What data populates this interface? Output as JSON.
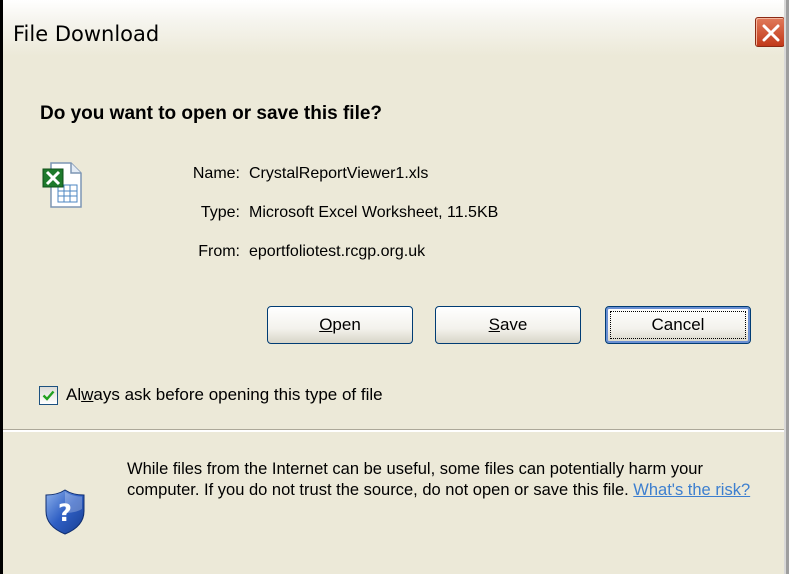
{
  "window": {
    "title": "File Download"
  },
  "dialog": {
    "question": "Do you want to open or save this file?",
    "file": {
      "icon": "excel-file-icon",
      "name_label": "Name:",
      "name_value": "CrystalReportViewer1.xls",
      "type_label": "Type:",
      "type_value": "Microsoft Excel Worksheet, 11.5KB",
      "from_label": "From:",
      "from_value": "eportfoliotest.rcgp.org.uk"
    },
    "buttons": {
      "open": {
        "label": "Open",
        "accel": "O"
      },
      "save": {
        "label": "Save",
        "accel": "S"
      },
      "cancel": {
        "label": "Cancel"
      }
    },
    "always_ask": {
      "checked": true,
      "label": "Always ask before opening this type of file",
      "accel": "w"
    },
    "warning": {
      "icon": "security-shield-question-icon",
      "text": "While files from the Internet can be useful, some files can potentially harm your computer. If you do not trust the source, do not open or save this file. ",
      "link": "What's the risk?"
    }
  },
  "colors": {
    "dialog_bg": "#ece9d8",
    "close_button": "#c1391a",
    "button_border": "#003c74",
    "link": "#3d7fcf",
    "checkmark": "#21a121"
  }
}
